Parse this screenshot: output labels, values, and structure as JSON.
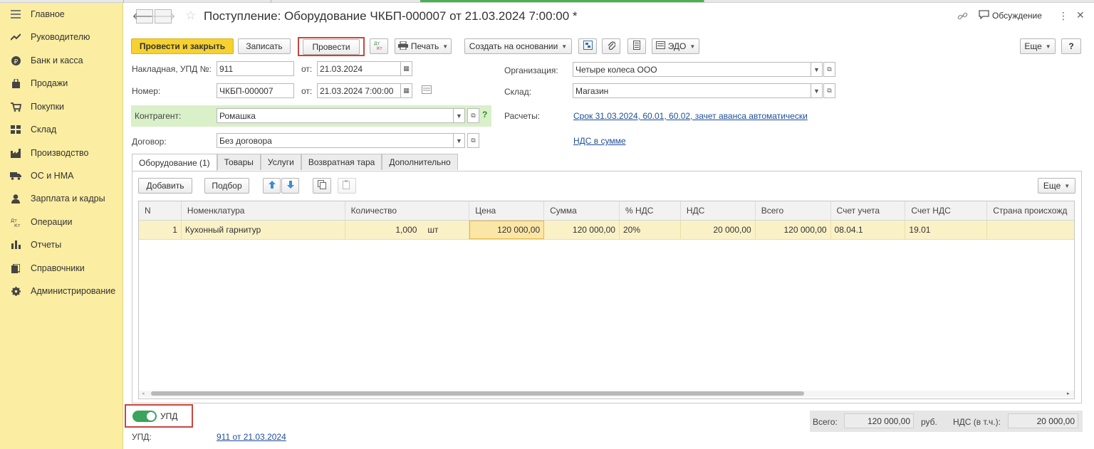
{
  "sidebar": {
    "items": [
      {
        "label": "Главное",
        "icon": "menu-lines-icon"
      },
      {
        "label": "Руководителю",
        "icon": "trend-up-icon"
      },
      {
        "label": "Банк и касса",
        "icon": "ruble-coin-icon"
      },
      {
        "label": "Продажи",
        "icon": "shopping-bag-icon"
      },
      {
        "label": "Покупки",
        "icon": "cart-icon"
      },
      {
        "label": "Склад",
        "icon": "warehouse-grid-icon"
      },
      {
        "label": "Производство",
        "icon": "factory-icon"
      },
      {
        "label": "ОС и НМА",
        "icon": "truck-icon"
      },
      {
        "label": "Зарплата и кадры",
        "icon": "person-icon"
      },
      {
        "label": "Операции",
        "icon": "dt-kt-icon"
      },
      {
        "label": "Отчеты",
        "icon": "bar-chart-icon"
      },
      {
        "label": "Справочники",
        "icon": "books-icon"
      },
      {
        "label": "Администрирование",
        "icon": "gear-icon"
      }
    ]
  },
  "header": {
    "title": "Поступление: Оборудование ЧКБП-000007 от 21.03.2024 7:00:00 *",
    "discussion_label": "Обсуждение"
  },
  "toolbar": {
    "post_close_label": "Провести и закрыть",
    "save_label": "Записать",
    "post_label": "Провести",
    "dtkt_label": "Дт Кт",
    "print_label": "Печать",
    "create_based_label": "Создать на основании",
    "edo_label": "ЭДО",
    "more_label": "Еще",
    "help_label": "?"
  },
  "form": {
    "invoice_label": "Накладная, УПД №:",
    "invoice_value": "911",
    "from_label": "от:",
    "invoice_date": "21.03.2024",
    "number_label": "Номер:",
    "number_value": "ЧКБП-000007",
    "number_date": "21.03.2024  7:00:00",
    "counterparty_label": "Контрагент:",
    "counterparty_value": "Ромашка",
    "contract_label": "Договор:",
    "contract_value": "Без договора",
    "organization_label": "Организация:",
    "organization_value": "Четыре колеса ООО",
    "warehouse_label": "Склад:",
    "warehouse_value": "Магазин",
    "settlements_label": "Расчеты:",
    "settlements_link": "Срок 31.03.2024, 60.01, 60.02, зачет аванса автоматически",
    "vat_link": "НДС в сумме",
    "help_mark": "?"
  },
  "tabs": [
    {
      "label": "Оборудование (1)",
      "active": true
    },
    {
      "label": "Товары",
      "active": false
    },
    {
      "label": "Услуги",
      "active": false
    },
    {
      "label": "Возвратная тара",
      "active": false
    },
    {
      "label": "Дополнительно",
      "active": false
    }
  ],
  "table_toolbar": {
    "add_label": "Добавить",
    "pick_label": "Подбор",
    "more_label": "Еще"
  },
  "table": {
    "columns": [
      "N",
      "Номенклатура",
      "Количество",
      "Цена",
      "Сумма",
      "% НДС",
      "НДС",
      "Всего",
      "Счет учета",
      "Счет НДС",
      "Страна происхожд"
    ],
    "rows": [
      {
        "n": "1",
        "item": "Кухонный гарнитур",
        "qty": "1,000",
        "unit": "шт",
        "price": "120 000,00",
        "sum": "120 000,00",
        "vat_rate": "20%",
        "vat": "20 000,00",
        "total": "120 000,00",
        "account": "08.04.1",
        "vat_account": "19.01",
        "country": ""
      }
    ]
  },
  "footer": {
    "upd_toggle_label": "УПД",
    "upd_on": true,
    "upd_label": "УПД:",
    "upd_link": "911 от 21.03.2024",
    "total_label": "Всего:",
    "total_value": "120 000,00",
    "currency": "руб.",
    "vat_included_label": "НДС (в т.ч.):",
    "vat_value": "20 000,00"
  },
  "colors": {
    "sidebar_bg": "#fbeda2",
    "primary_button": "#f7d12e",
    "highlight_box": "#c9463d",
    "toggle_on": "#3aa35c",
    "selected_row": "#fbf1c7",
    "link": "#1f4e9a"
  }
}
